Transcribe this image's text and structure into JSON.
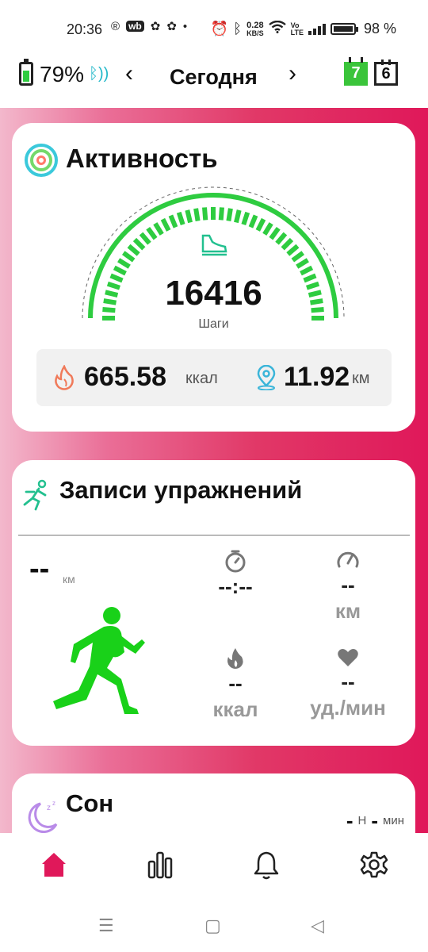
{
  "status_bar": {
    "time": "20:36",
    "net_speed": "0.28",
    "net_unit": "KB/S",
    "battery": "98 %"
  },
  "top_bar": {
    "device_battery": "79%",
    "date_label": "Сегодня",
    "calendar_today": "7",
    "calendar_other": "6"
  },
  "activity": {
    "title": "Активность",
    "steps": "16416",
    "steps_label": "Шаги",
    "steps_progress_fraction": 1.0,
    "calories_value": "665.58",
    "calories_unit": "ккал",
    "distance_value": "11.92",
    "distance_unit": "км"
  },
  "exercise": {
    "title": "Записи упражнений",
    "distance_value": "--",
    "distance_unit": "км",
    "duration_value": "--:--",
    "pace_value": "--",
    "pace_unit": "км",
    "calories_value": "--",
    "calories_unit": "ккал",
    "heart_value": "--",
    "heart_unit": "уд./мин"
  },
  "sleep": {
    "title": "Сон",
    "hours_value": "-",
    "hours_unit": "Н",
    "minutes_value": "-",
    "minutes_unit": "мин"
  },
  "colors": {
    "accent_pink": "#e0185a",
    "green": "#2ecc40",
    "teal": "#22b8c9"
  },
  "bottom_nav": [
    "home-icon",
    "stats-icon",
    "bell-icon",
    "gear-icon"
  ]
}
